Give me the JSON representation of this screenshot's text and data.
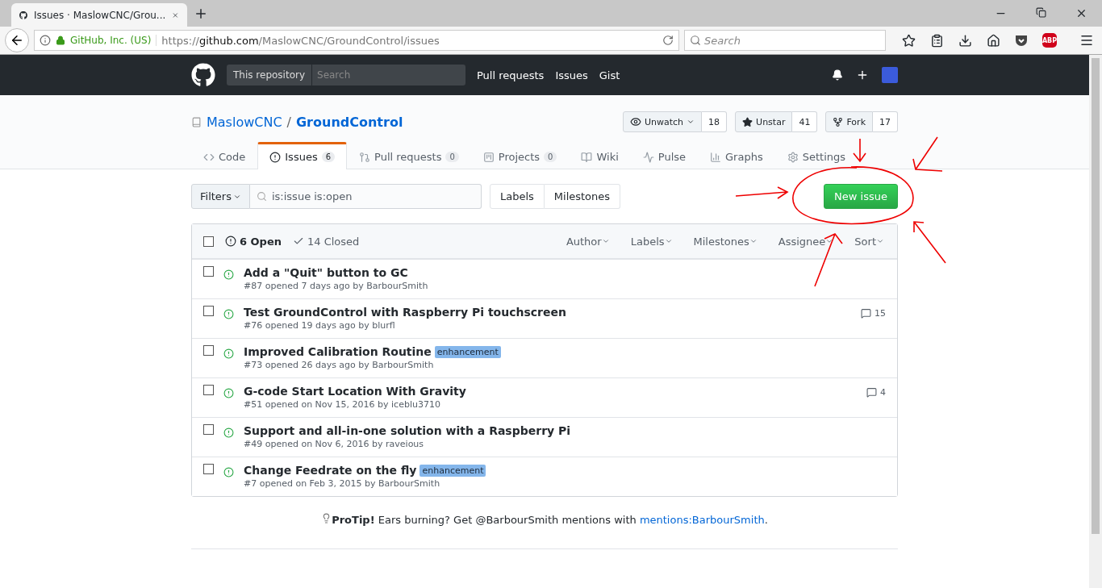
{
  "browser": {
    "tab_title": "Issues · MaslowCNC/Grou...",
    "identity": "GitHub, Inc. (US)",
    "url_prefix": "https://",
    "url_host": "github.com",
    "url_path": "/MaslowCNC/GroundControl/issues",
    "search_placeholder": "Search",
    "adblock_badge": "ABP"
  },
  "header": {
    "scope": "This repository",
    "search_placeholder": "Search",
    "nav": [
      "Pull requests",
      "Issues",
      "Gist"
    ]
  },
  "repo": {
    "owner": "MaslowCNC",
    "separator": "/",
    "name": "GroundControl",
    "actions": [
      {
        "kind": "watch",
        "label": "Unwatch",
        "count": "18"
      },
      {
        "kind": "star",
        "label": "Unstar",
        "count": "41"
      },
      {
        "kind": "fork",
        "label": "Fork",
        "count": "17"
      }
    ]
  },
  "tabs": [
    {
      "kind": "code",
      "label": "Code",
      "selected": false
    },
    {
      "kind": "issues",
      "label": "Issues",
      "count": "6",
      "selected": true
    },
    {
      "kind": "pulls",
      "label": "Pull requests",
      "count": "0",
      "selected": false
    },
    {
      "kind": "projects",
      "label": "Projects",
      "count": "0",
      "selected": false
    },
    {
      "kind": "wiki",
      "label": "Wiki",
      "selected": false
    },
    {
      "kind": "pulse",
      "label": "Pulse",
      "selected": false
    },
    {
      "kind": "graphs",
      "label": "Graphs",
      "selected": false
    },
    {
      "kind": "settings",
      "label": "Settings",
      "selected": false
    }
  ],
  "filters": {
    "button": "Filters",
    "query": "is:issue is:open",
    "labels": "Labels",
    "milestones": "Milestones",
    "new_issue": "New issue"
  },
  "list_header": {
    "select_all_checked": false,
    "states": [
      {
        "kind": "open",
        "label": "6 Open",
        "selected": true
      },
      {
        "kind": "closed",
        "label": "14 Closed",
        "selected": false
      }
    ],
    "menus": [
      "Author",
      "Labels",
      "Milestones",
      "Assignee",
      "Sort"
    ]
  },
  "issues": [
    {
      "title": "Add a \"Quit\" button to GC",
      "meta": "#87 opened 7 days ago by BarbourSmith",
      "checked": false
    },
    {
      "title": "Test GroundControl with Raspberry Pi touchscreen",
      "meta": "#76 opened 19 days ago by blurfl",
      "comments": "15",
      "checked": false
    },
    {
      "title": "Improved Calibration Routine",
      "label": "enhancement",
      "meta": "#73 opened 26 days ago by BarbourSmith",
      "checked": false
    },
    {
      "title": "G-code Start Location With Gravity",
      "meta": "#51 opened on Nov 15, 2016 by iceblu3710",
      "comments": "4",
      "checked": false
    },
    {
      "title": "Support and all-in-one solution with a Raspberry Pi",
      "meta": "#49 opened on Nov 6, 2016 by raveious",
      "checked": false
    },
    {
      "title": "Change Feedrate on the fly",
      "label": "enhancement",
      "meta": "#7 opened on Feb 3, 2015 by BarbourSmith",
      "checked": false
    }
  ],
  "protip": {
    "text": "**ProTip!** Ears burning? Get @BarbourSmith mentions with ",
    "link": "mentions:BarbourSmith",
    "end": "."
  }
}
